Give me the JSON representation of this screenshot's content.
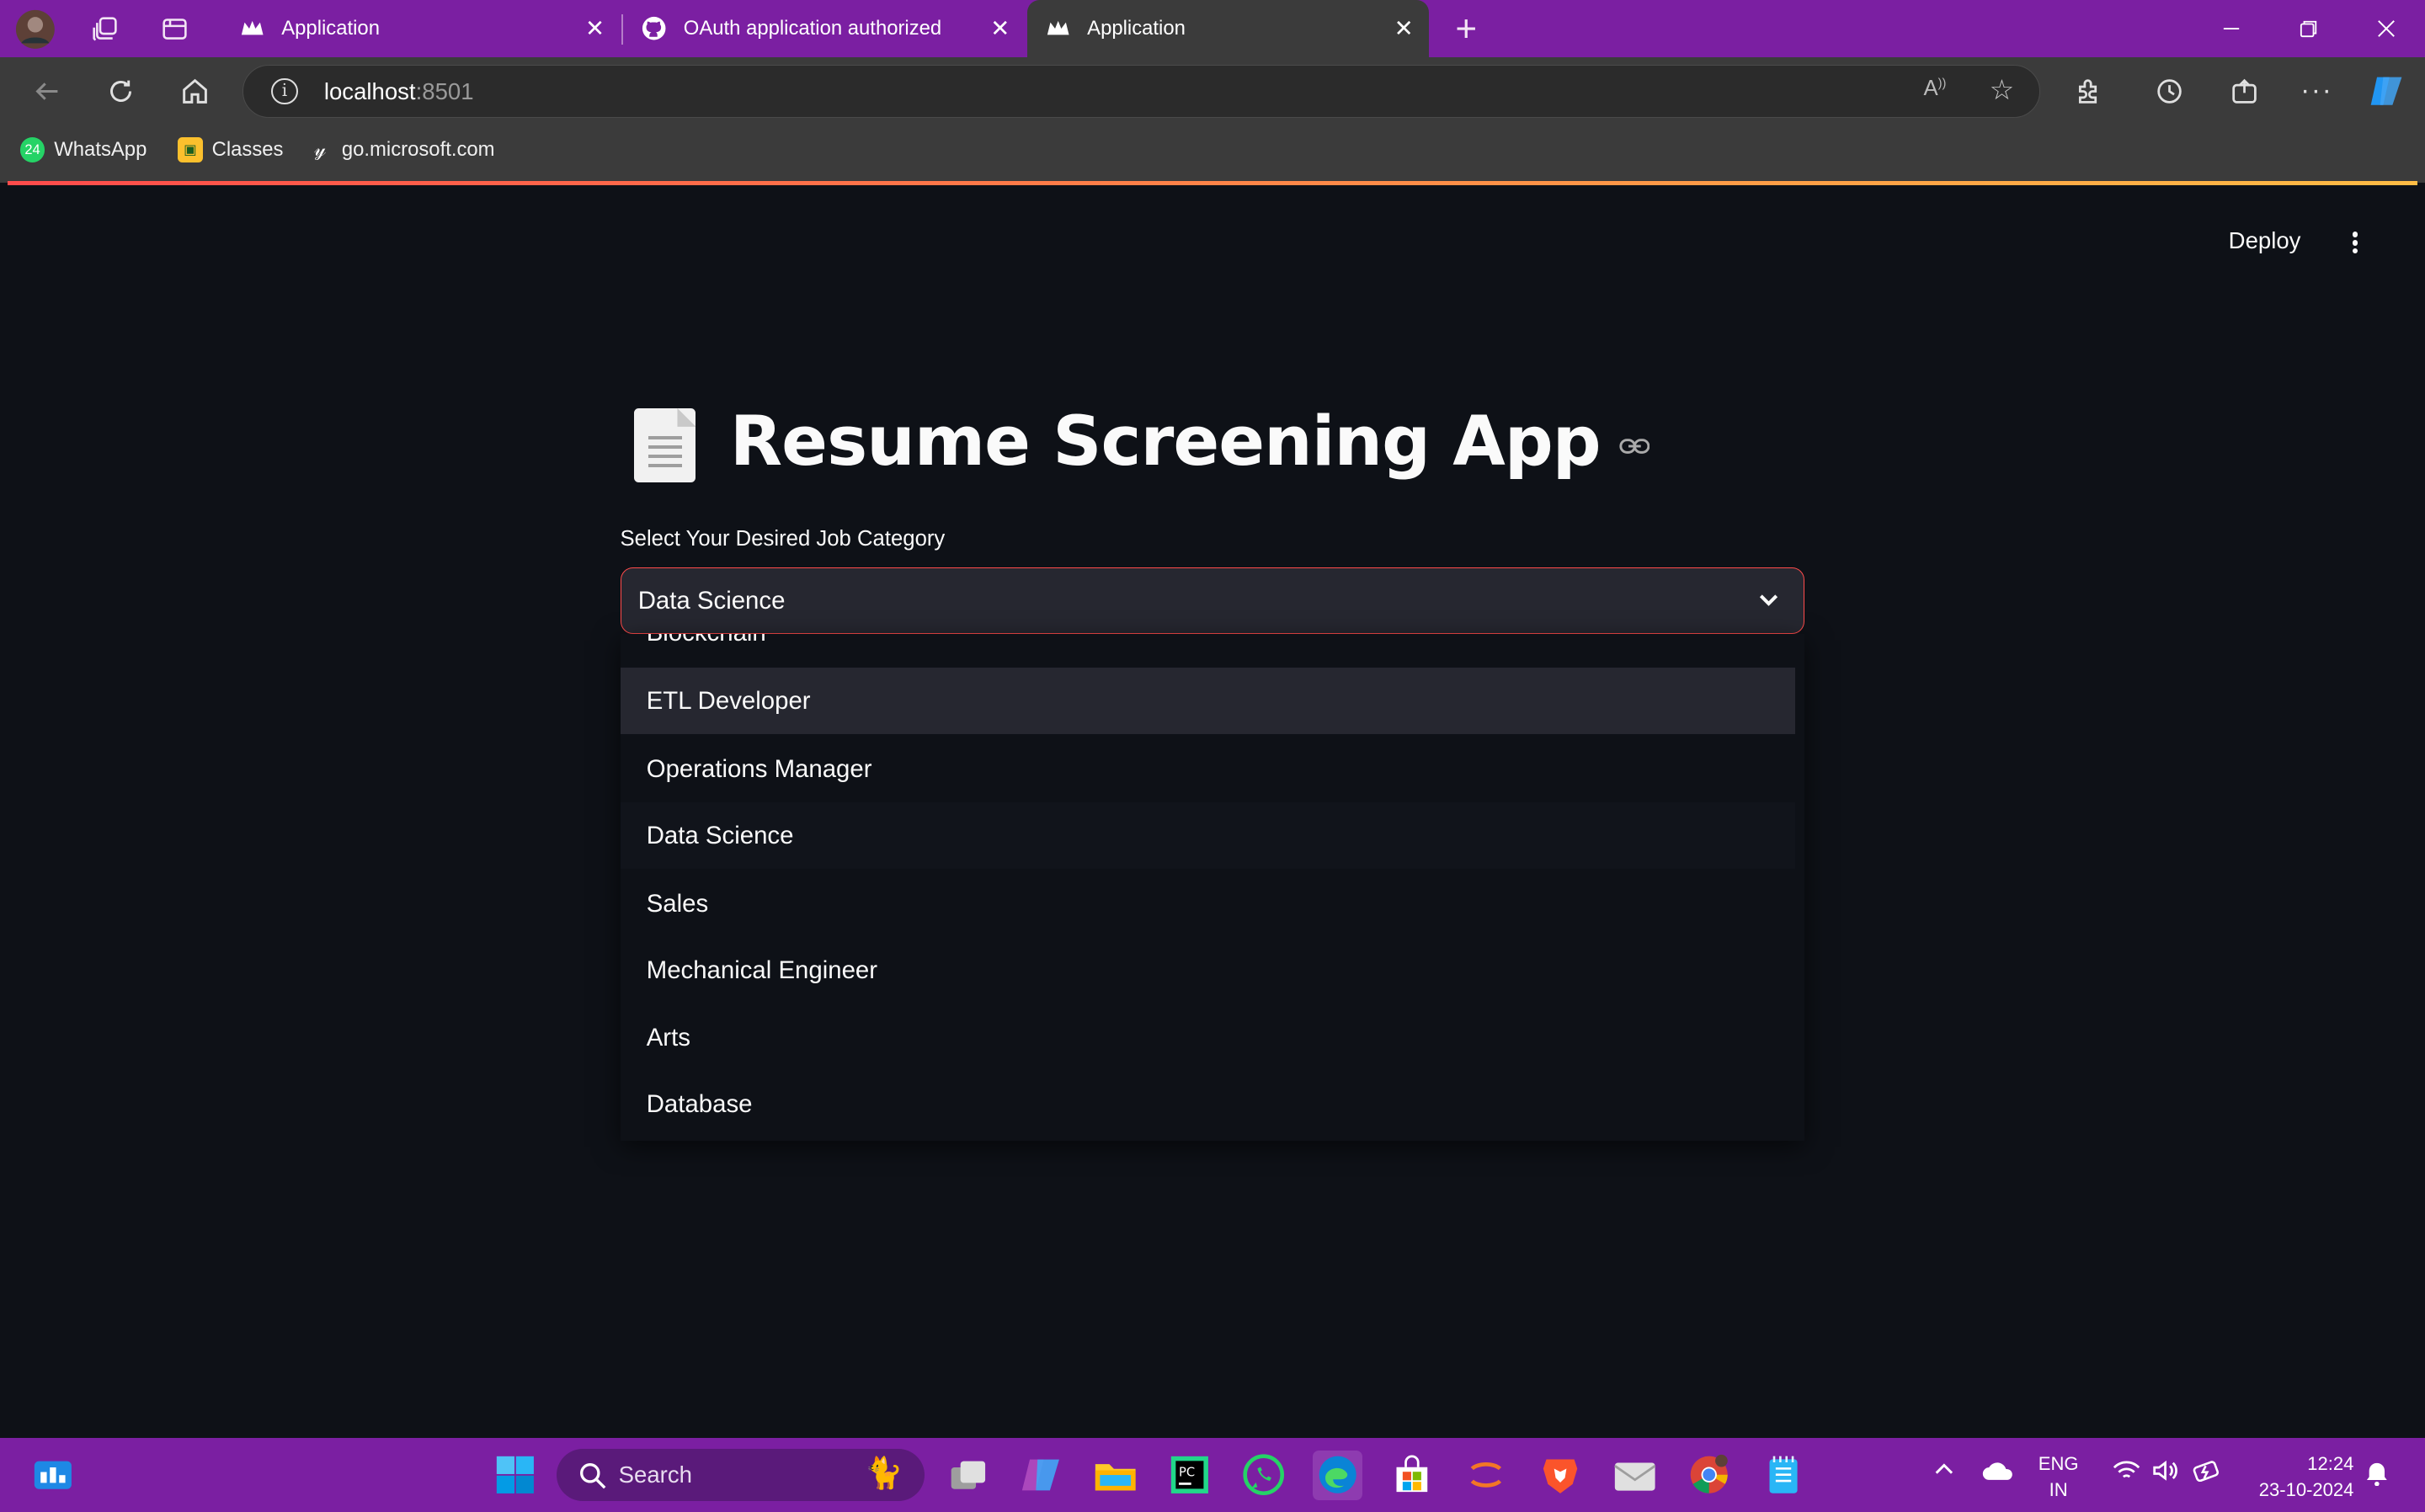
{
  "browser": {
    "tabs": [
      {
        "title": "Application"
      },
      {
        "title": "OAuth application authorized"
      },
      {
        "title": "Application"
      }
    ],
    "new_tab": "+",
    "address": {
      "host": "localhost",
      "port": ":8501"
    },
    "bookmarks": [
      {
        "label": "WhatsApp"
      },
      {
        "label": "Classes"
      },
      {
        "label": "go.microsoft.com"
      }
    ]
  },
  "app": {
    "deploy_label": "Deploy",
    "title": "Resume Screening App",
    "select_label": "Select Your Desired Job Category",
    "selected_value": "Data Science",
    "partial_option": "Blockchain",
    "options": [
      {
        "label": "ETL Developer",
        "state": "hover"
      },
      {
        "label": "Operations Manager",
        "state": "normal"
      },
      {
        "label": "Data Science",
        "state": "selected"
      },
      {
        "label": "Sales",
        "state": "normal"
      },
      {
        "label": "Mechanical Engineer",
        "state": "normal"
      },
      {
        "label": "Arts",
        "state": "normal"
      },
      {
        "label": "Database",
        "state": "normal"
      }
    ]
  },
  "taskbar": {
    "search_placeholder": "Search",
    "lang_top": "ENG",
    "lang_bottom": "IN",
    "time": "12:24",
    "date": "23-10-2024"
  },
  "colors": {
    "accent": "#ff4b4b",
    "tabstrip": "#7b1fa2",
    "app_bg": "#0e1117",
    "widget_bg": "#262730"
  }
}
